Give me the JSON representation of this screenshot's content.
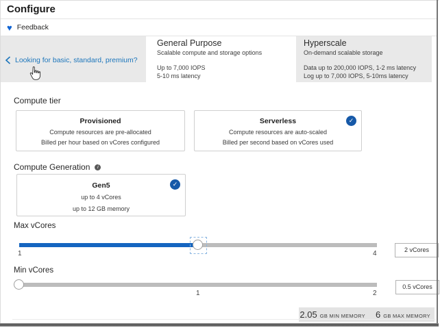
{
  "page": {
    "title": "Configure"
  },
  "feedback": {
    "label": "Feedback"
  },
  "tier_banner": {
    "back_link": "Looking for basic, standard, premium?",
    "cards": [
      {
        "name": "General Purpose",
        "desc": "Scalable compute and storage options",
        "lines": [
          "Up to 7,000 IOPS",
          "5-10 ms latency"
        ],
        "selected": false
      },
      {
        "name": "Hyperscale",
        "desc": "On-demand scalable storage",
        "lines": [
          "Data up to 200,000 IOPS, 1-2 ms latency",
          "Log up to 7,000 IOPS, 5-10ms latency"
        ],
        "selected": true
      }
    ]
  },
  "compute_tier": {
    "label": "Compute tier",
    "cards": [
      {
        "title": "Provisioned",
        "line1": "Compute resources are pre-allocated",
        "line2": "Billed per hour based on vCores configured",
        "selected": false
      },
      {
        "title": "Serverless",
        "line1": "Compute resources are auto-scaled",
        "line2": "Billed per second based on vCores used",
        "selected": true
      }
    ]
  },
  "compute_generation": {
    "label": "Compute Generation",
    "card": {
      "title": "Gen5",
      "line1": "up to 4 vCores",
      "line2": "up to 12 GB memory",
      "selected": true
    }
  },
  "sliders": {
    "max_vcores": {
      "label": "Max vCores",
      "ticks": [
        "1",
        "4"
      ],
      "value": "2 vCores",
      "percent": 50
    },
    "min_vcores": {
      "label": "Min vCores",
      "ticks": [
        "1",
        "2"
      ],
      "value": "0.5 vCores",
      "percent": 0
    }
  },
  "memory_summary": {
    "min": {
      "value": "2.05",
      "unit": "GB MIN MEMORY"
    },
    "max": {
      "value": "6",
      "unit": "GB MAX MEMORY"
    }
  },
  "colors": {
    "accent": "#1b75bb",
    "heart": "#1064d4",
    "check": "#1659a8",
    "slider-fill": "#1565c0",
    "card-gray": "#e9e9e9",
    "track-gray": "#bcbcbc",
    "memory-bar": "#e3e3e3"
  }
}
